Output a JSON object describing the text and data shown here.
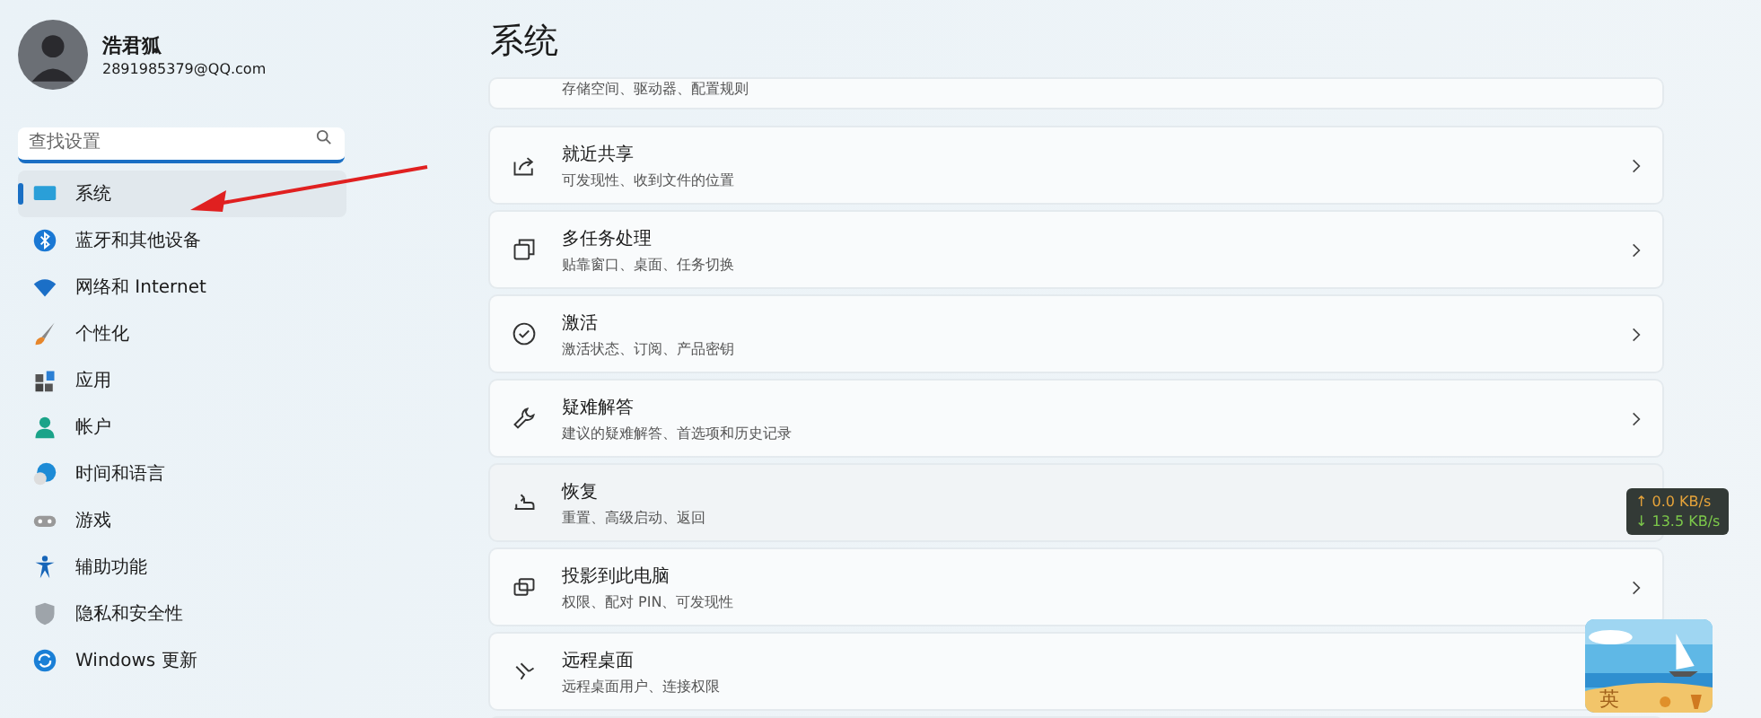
{
  "user": {
    "name": "浩君狐",
    "email": "2891985379@QQ.com"
  },
  "search": {
    "placeholder": "查找设置"
  },
  "sidebar": {
    "items": [
      {
        "label": "系统",
        "selected": true
      },
      {
        "label": "蓝牙和其他设备",
        "selected": false
      },
      {
        "label": "网络和 Internet",
        "selected": false
      },
      {
        "label": "个性化",
        "selected": false
      },
      {
        "label": "应用",
        "selected": false
      },
      {
        "label": "帐户",
        "selected": false
      },
      {
        "label": "时间和语言",
        "selected": false
      },
      {
        "label": "游戏",
        "selected": false
      },
      {
        "label": "辅助功能",
        "selected": false
      },
      {
        "label": "隐私和安全性",
        "selected": false
      },
      {
        "label": "Windows 更新",
        "selected": false
      }
    ]
  },
  "page_title": "系统",
  "settings": [
    {
      "kind": "partial",
      "subtitle": "存储空间、驱动器、配置规则"
    },
    {
      "kind": "full",
      "title": "就近共享",
      "subtitle": "可发现性、收到文件的位置"
    },
    {
      "kind": "full",
      "title": "多任务处理",
      "subtitle": "贴靠窗口、桌面、任务切换"
    },
    {
      "kind": "full",
      "title": "激活",
      "subtitle": "激活状态、订阅、产品密钥"
    },
    {
      "kind": "full",
      "title": "疑难解答",
      "subtitle": "建议的疑难解答、首选项和历史记录"
    },
    {
      "kind": "full",
      "title": "恢复",
      "subtitle": "重置、高级启动、返回"
    },
    {
      "kind": "full",
      "title": "投影到此电脑",
      "subtitle": "权限、配对 PIN、可发现性"
    },
    {
      "kind": "full",
      "title": "远程桌面",
      "subtitle": "远程桌面用户、连接权限"
    }
  ],
  "net_speed": {
    "up": "↑ 0.0 KB/s",
    "down": "↓ 13.5 KB/s"
  },
  "ime_widget": {
    "label": "英"
  }
}
